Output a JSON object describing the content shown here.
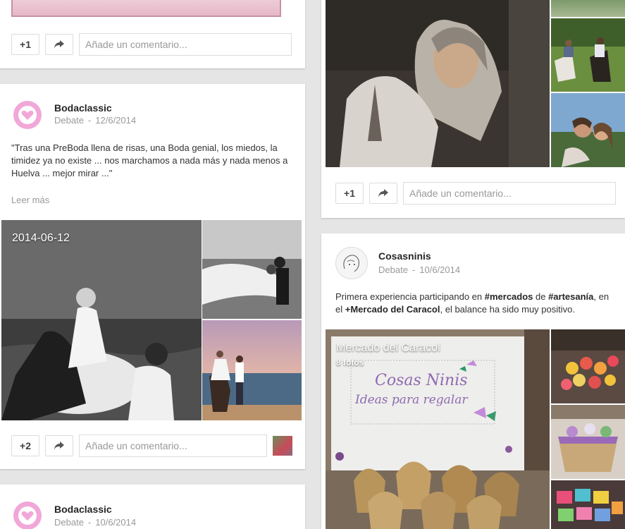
{
  "common": {
    "comment_placeholder": "Añade un comentario...",
    "meta_separator": "-",
    "share_icon": "share-arrow-icon"
  },
  "post_top_left": {
    "plus_label": "+1"
  },
  "post_bodaclassic_1": {
    "author": "Bodaclassic",
    "type": "Debate",
    "date": "12/6/2014",
    "text": "\"Tras una PreBoda llena de risas, una Boda genial, los miedos, la timidez ya no existe ... nos marchamos a nada más y nada menos a Huelva ... mejor mirar ...\"",
    "read_more": "Leer más",
    "album_title": "2014-06-12",
    "plus_label": "+2"
  },
  "post_bodaclassic_2": {
    "author": "Bodaclassic",
    "type": "Debate",
    "date": "10/6/2014"
  },
  "post_top_right": {
    "plus_label": "+1"
  },
  "post_cosasninis": {
    "author": "Cosasninis",
    "type": "Debate",
    "date": "10/6/2014",
    "text_parts": [
      "Primera experiencia participando en ",
      "#mercados",
      " de ",
      "#artesanía",
      ", en el ",
      "+Mercado del Caracol",
      ",  el balance ha sido muy positivo."
    ],
    "album_title": "Mercado del Caracol",
    "album_count": "8 fotos",
    "sign_line1": "Cosas Ninis",
    "sign_line2": "Ideas para regalar"
  },
  "colors": {
    "avatar_pink": "#f1a7d8",
    "link_dark": "#262626"
  }
}
